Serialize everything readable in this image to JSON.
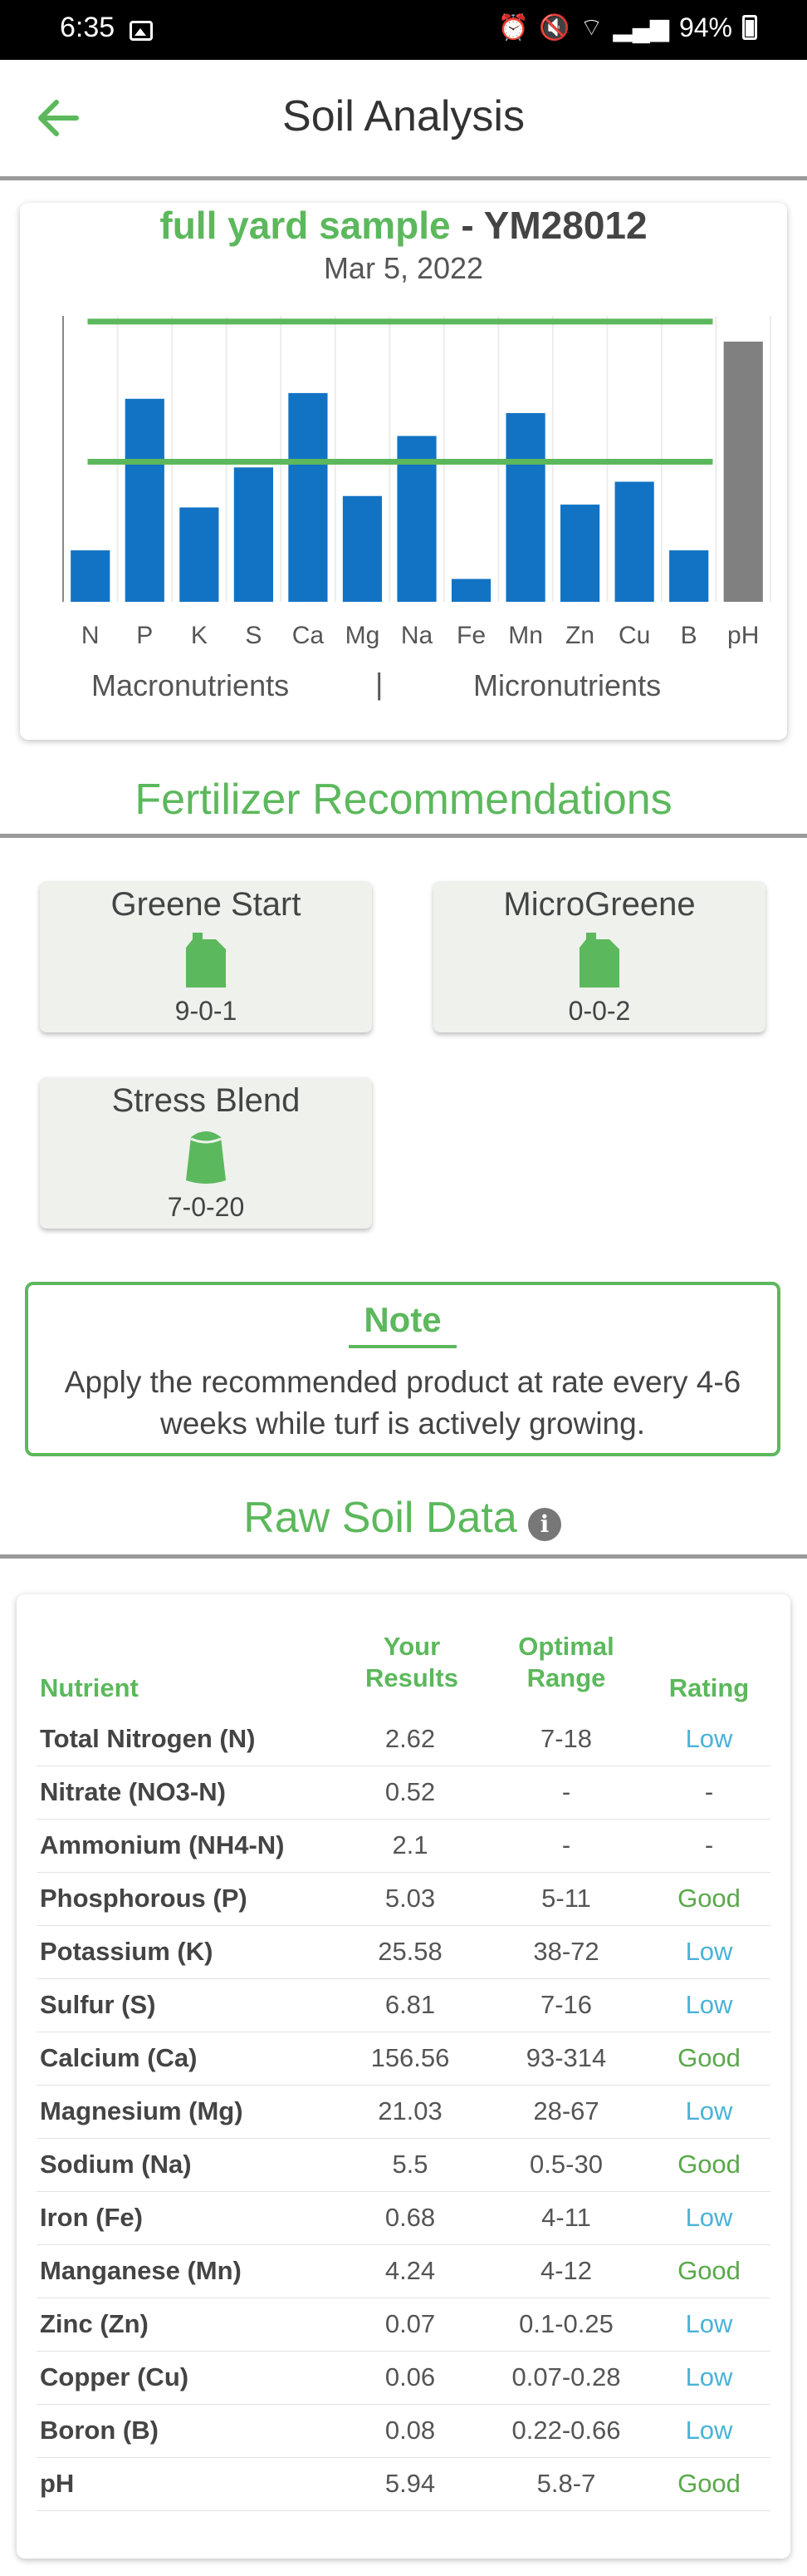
{
  "status_bar": {
    "time": "6:35",
    "battery": "94%"
  },
  "header": {
    "title": "Soil Analysis"
  },
  "chart": {
    "sample_name": "full yard sample",
    "sample_id": "- YM28012",
    "date": "Mar 5, 2022",
    "macro_label": "Macronutrients",
    "separator": "|",
    "micro_label": "Micronutrients",
    "colors": {
      "bar": "#1273c4",
      "ph_bar": "#808080",
      "optimal_line": "#5cb85c"
    }
  },
  "chart_data": {
    "type": "bar",
    "categories": [
      "N",
      "P",
      "K",
      "S",
      "Ca",
      "Mg",
      "Na",
      "Fe",
      "Mn",
      "Zn",
      "Cu",
      "B",
      "pH"
    ],
    "values": [
      18,
      71,
      33,
      47,
      73,
      37,
      58,
      8,
      66,
      34,
      42,
      18,
      91
    ],
    "ylim": [
      0,
      100
    ],
    "reference_lines": [
      98,
      49
    ],
    "grid": "vertical",
    "legend": "none"
  },
  "recommendations": {
    "title": "Fertilizer Recommendations",
    "products": [
      {
        "name": "Greene Start",
        "npk": "9-0-1",
        "icon": "jug-icon"
      },
      {
        "name": "MicroGreene",
        "npk": "0-0-2",
        "icon": "jug-icon"
      },
      {
        "name": "Stress Blend",
        "npk": "7-0-20",
        "icon": "bag-icon"
      }
    ]
  },
  "note": {
    "title": "Note",
    "text": "Apply the recommended product at rate every 4-6 weeks while turf is actively growing."
  },
  "raw": {
    "title": "Raw Soil Data",
    "headers": {
      "nutrient": "Nutrient",
      "results_1": "Your",
      "results_2": "Results",
      "optimal_1": "Optimal",
      "optimal_2": "Range",
      "rating": "Rating"
    },
    "rows": [
      {
        "nutrient": "Total Nitrogen (N)",
        "result": "2.62",
        "range": "7-18",
        "rating": "Low"
      },
      {
        "nutrient": "Nitrate (NO3-N)",
        "result": "0.52",
        "range": "-",
        "rating": "-"
      },
      {
        "nutrient": "Ammonium (NH4-N)",
        "result": "2.1",
        "range": "-",
        "rating": "-"
      },
      {
        "nutrient": "Phosphorous (P)",
        "result": "5.03",
        "range": "5-11",
        "rating": "Good"
      },
      {
        "nutrient": "Potassium (K)",
        "result": "25.58",
        "range": "38-72",
        "rating": "Low"
      },
      {
        "nutrient": "Sulfur (S)",
        "result": "6.81",
        "range": "7-16",
        "rating": "Low"
      },
      {
        "nutrient": "Calcium (Ca)",
        "result": "156.56",
        "range": "93-314",
        "rating": "Good"
      },
      {
        "nutrient": "Magnesium (Mg)",
        "result": "21.03",
        "range": "28-67",
        "rating": "Low"
      },
      {
        "nutrient": "Sodium (Na)",
        "result": "5.5",
        "range": "0.5-30",
        "rating": "Good"
      },
      {
        "nutrient": "Iron (Fe)",
        "result": "0.68",
        "range": "4-11",
        "rating": "Low"
      },
      {
        "nutrient": "Manganese (Mn)",
        "result": "4.24",
        "range": "4-12",
        "rating": "Good"
      },
      {
        "nutrient": "Zinc (Zn)",
        "result": "0.07",
        "range": "0.1-0.25",
        "rating": "Low"
      },
      {
        "nutrient": "Copper (Cu)",
        "result": "0.06",
        "range": "0.07-0.28",
        "rating": "Low"
      },
      {
        "nutrient": "Boron (B)",
        "result": "0.08",
        "range": "0.22-0.66",
        "rating": "Low"
      },
      {
        "nutrient": "pH",
        "result": "5.94",
        "range": "5.8-7",
        "rating": "Good"
      }
    ]
  }
}
